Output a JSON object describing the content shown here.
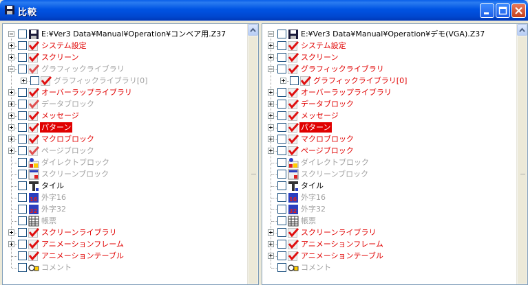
{
  "window": {
    "title": "比較"
  },
  "colors": {
    "diff": "#e00000",
    "same": "#a0a0a0",
    "selected_bg": "#e00000"
  },
  "left": {
    "root_path": "E:¥Ver3 Data¥Manual¥Operation¥コンベア用.Z37",
    "items": [
      {
        "label": "システム設定",
        "icon": "red-check-icon",
        "color": "red",
        "expander": "plus",
        "level": 1
      },
      {
        "label": "スクリーン",
        "icon": "red-check-icon",
        "color": "red",
        "expander": "plus",
        "level": 1
      },
      {
        "label": "グラフィックライブラリ",
        "icon": "gray-check-icon",
        "color": "gray",
        "expander": "minus",
        "level": 1
      },
      {
        "label": "グラフィックライブラリ[0]",
        "icon": "red-check-icon",
        "color": "gray",
        "expander": "plus",
        "level": 2
      },
      {
        "label": "オーバーラップライブラリ",
        "icon": "red-check-icon",
        "color": "red",
        "expander": "plus",
        "level": 1
      },
      {
        "label": "データブロック",
        "icon": "gray-check-icon",
        "color": "gray",
        "expander": "plus",
        "level": 1
      },
      {
        "label": "メッセージ",
        "icon": "red-check-icon",
        "color": "red",
        "expander": "plus",
        "level": 1
      },
      {
        "label": "パターン",
        "icon": "red-check-icon",
        "color": "selected",
        "expander": "plus",
        "level": 1
      },
      {
        "label": "マクロブロック",
        "icon": "red-check-icon",
        "color": "red",
        "expander": "plus",
        "level": 1
      },
      {
        "label": "ページブロック",
        "icon": "gray-check-icon",
        "color": "gray",
        "expander": "plus",
        "level": 1
      },
      {
        "label": "ダイレクトブロック",
        "icon": "direct-block-icon",
        "color": "gray",
        "expander": "",
        "level": 1
      },
      {
        "label": "スクリーンブロック",
        "icon": "screen-block-icon",
        "color": "gray",
        "expander": "",
        "level": 1
      },
      {
        "label": "タイル",
        "icon": "tile-icon",
        "color": "black",
        "expander": "",
        "level": 1
      },
      {
        "label": "外字16",
        "icon": "font16-icon",
        "color": "gray",
        "expander": "",
        "level": 1
      },
      {
        "label": "外字32",
        "icon": "font32-icon",
        "color": "gray",
        "expander": "",
        "level": 1
      },
      {
        "label": "帳票",
        "icon": "report-icon",
        "color": "gray",
        "expander": "",
        "level": 1
      },
      {
        "label": "スクリーンライブラリ",
        "icon": "red-check-icon",
        "color": "red",
        "expander": "plus",
        "level": 1
      },
      {
        "label": "アニメーションフレーム",
        "icon": "red-check-icon",
        "color": "red",
        "expander": "plus",
        "level": 1
      },
      {
        "label": "アニメーションテーブル",
        "icon": "red-check-icon",
        "color": "red",
        "expander": "",
        "level": 1
      },
      {
        "label": "コメント",
        "icon": "comment-icon",
        "color": "gray",
        "expander": "",
        "level": 1
      }
    ]
  },
  "right": {
    "root_path": "E:¥Ver3 Data¥Manual¥Operation¥デモ(VGA).Z37",
    "items": [
      {
        "label": "システム設定",
        "icon": "red-check-icon",
        "color": "red",
        "expander": "plus",
        "level": 1
      },
      {
        "label": "スクリーン",
        "icon": "red-check-icon",
        "color": "red",
        "expander": "plus",
        "level": 1
      },
      {
        "label": "グラフィックライブラリ",
        "icon": "red-check-icon",
        "color": "red",
        "expander": "minus",
        "level": 1
      },
      {
        "label": "グラフィックライブラリ[0]",
        "icon": "red-check-icon",
        "color": "red",
        "expander": "plus",
        "level": 2
      },
      {
        "label": "オーバーラップライブラリ",
        "icon": "red-check-icon",
        "color": "red",
        "expander": "plus",
        "level": 1
      },
      {
        "label": "データブロック",
        "icon": "red-check-icon",
        "color": "red",
        "expander": "plus",
        "level": 1
      },
      {
        "label": "メッセージ",
        "icon": "red-check-icon",
        "color": "red",
        "expander": "plus",
        "level": 1
      },
      {
        "label": "パターン",
        "icon": "red-check-icon",
        "color": "selected",
        "expander": "plus",
        "level": 1
      },
      {
        "label": "マクロブロック",
        "icon": "red-check-icon",
        "color": "red",
        "expander": "plus",
        "level": 1
      },
      {
        "label": "ページブロック",
        "icon": "red-check-icon",
        "color": "red",
        "expander": "plus",
        "level": 1
      },
      {
        "label": "ダイレクトブロック",
        "icon": "direct-block-icon",
        "color": "gray",
        "expander": "",
        "level": 1
      },
      {
        "label": "スクリーンブロック",
        "icon": "screen-block-icon",
        "color": "gray",
        "expander": "",
        "level": 1
      },
      {
        "label": "タイル",
        "icon": "tile-icon",
        "color": "black",
        "expander": "",
        "level": 1
      },
      {
        "label": "外字16",
        "icon": "font16-icon",
        "color": "gray",
        "expander": "",
        "level": 1
      },
      {
        "label": "外字32",
        "icon": "font32-icon",
        "color": "gray",
        "expander": "",
        "level": 1
      },
      {
        "label": "帳票",
        "icon": "report-icon",
        "color": "gray",
        "expander": "",
        "level": 1
      },
      {
        "label": "スクリーンライブラリ",
        "icon": "red-check-icon",
        "color": "red",
        "expander": "plus",
        "level": 1
      },
      {
        "label": "アニメーションフレーム",
        "icon": "red-check-icon",
        "color": "red",
        "expander": "plus",
        "level": 1
      },
      {
        "label": "アニメーションテーブル",
        "icon": "red-check-icon",
        "color": "red",
        "expander": "plus",
        "level": 1
      },
      {
        "label": "コメント",
        "icon": "comment-icon",
        "color": "gray",
        "expander": "",
        "level": 1
      }
    ]
  }
}
